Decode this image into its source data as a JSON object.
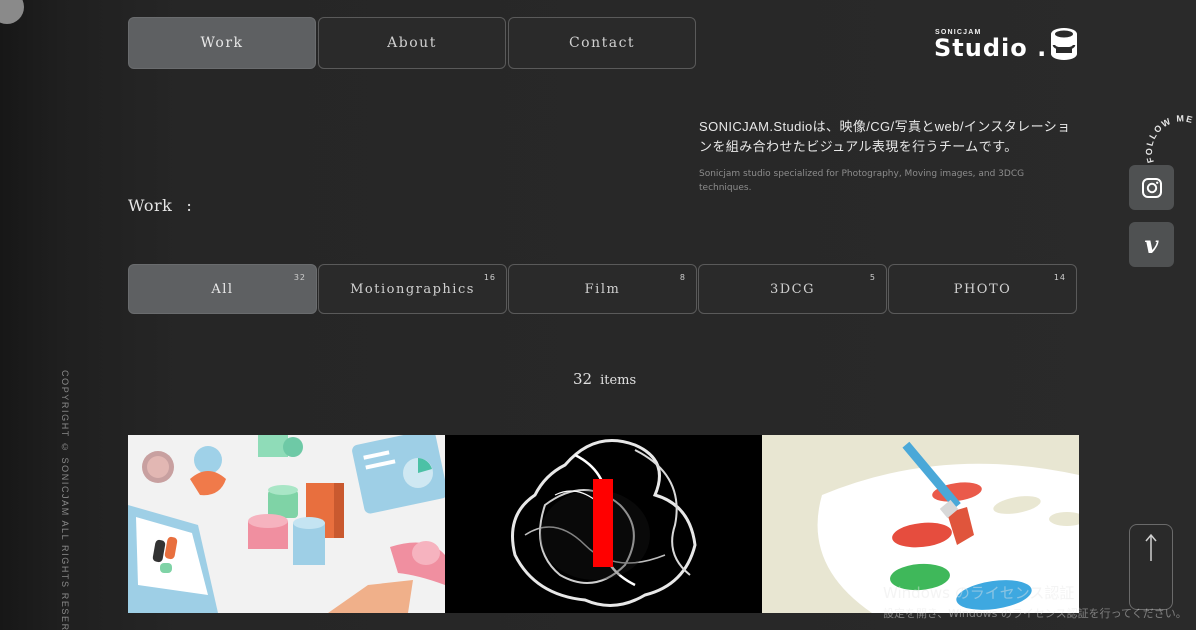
{
  "nav": {
    "items": [
      {
        "label": "Work",
        "active": true
      },
      {
        "label": "About",
        "active": false
      },
      {
        "label": "Contact",
        "active": false
      }
    ]
  },
  "logo": {
    "small": "SONICJAM",
    "big": "Studio ."
  },
  "intro": {
    "jp": "SONICJAM.Studioは、映像/CG/写真とweb/インスタレーションを組み合わせたビジュアル表現を行うチームです。",
    "en": "Sonicjam studio specialized for Photography, Moving images, and 3DCG techniques."
  },
  "section": {
    "title": "Work",
    "colon": ":"
  },
  "filters": [
    {
      "label": "All",
      "count": "32",
      "active": true
    },
    {
      "label": "Motiongraphics",
      "count": "16",
      "active": false
    },
    {
      "label": "Film",
      "count": "8",
      "active": false
    },
    {
      "label": "3DCG",
      "count": "5",
      "active": false
    },
    {
      "label": "PHOTO",
      "count": "14",
      "active": false
    }
  ],
  "items_count": {
    "number": "32",
    "label": "items"
  },
  "follow_text": "FOLLOW ME ! FOLLO",
  "copyright": "COPYRIGHT © SONICJAM ALL RIGHTS RESERVED",
  "social": [
    {
      "icon": "instagram-icon"
    },
    {
      "icon": "vimeo-icon",
      "glyph": "v"
    }
  ],
  "scroll_top": {
    "icon": "arrow-up-icon"
  },
  "windows_notice": {
    "line1": "Windows のライセンス認証",
    "line2": "設定を開き、Windows のライセンス認証を行ってください。"
  },
  "colors": {
    "active_bg": "#5e6062",
    "border": "#5a5a5a",
    "bg": "#2a2a2a"
  }
}
